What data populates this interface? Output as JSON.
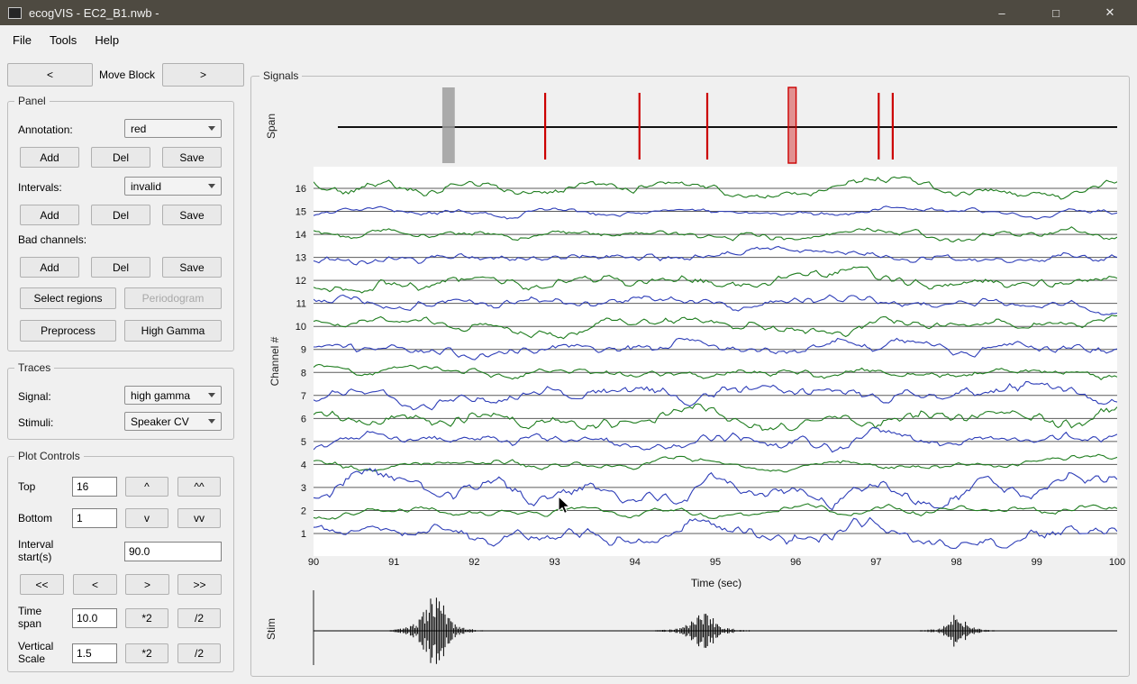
{
  "window": {
    "title": "ecogVIS - EC2_B1.nwb -",
    "minimize": "–",
    "maximize": "□",
    "close": "✕"
  },
  "menu": {
    "file": "File",
    "tools": "Tools",
    "help": "Help"
  },
  "move_block": {
    "prev": "<",
    "label": "Move Block",
    "next": ">"
  },
  "panel": {
    "title": "Panel",
    "annotation": {
      "label": "Annotation:",
      "value": "red",
      "add": "Add",
      "del": "Del",
      "save": "Save"
    },
    "intervals": {
      "label": "Intervals:",
      "value": "invalid",
      "add": "Add",
      "del": "Del",
      "save": "Save"
    },
    "bad_channels": {
      "label": "Bad channels:",
      "add": "Add",
      "del": "Del",
      "save": "Save"
    },
    "select_regions": "Select regions",
    "periodogram": "Periodogram",
    "preprocess": "Preprocess",
    "high_gamma": "High Gamma"
  },
  "traces": {
    "title": "Traces",
    "signal": {
      "label": "Signal:",
      "value": "high gamma"
    },
    "stimuli": {
      "label": "Stimuli:",
      "value": "Speaker CV"
    }
  },
  "plot_controls": {
    "title": "Plot Controls",
    "top": {
      "label": "Top",
      "value": "16",
      "up": "^",
      "up2": "^^"
    },
    "bottom": {
      "label": "Bottom",
      "value": "1",
      "down": "v",
      "down2": "vv"
    },
    "interval_start": {
      "label_line1": "Interval",
      "label_line2": "start(s)",
      "value": "90.0"
    },
    "nav": {
      "first": "<<",
      "prev": "<",
      "next": ">",
      "last": ">>"
    },
    "time_span": {
      "label_line1": "Time",
      "label_line2": "span",
      "value": "10.0",
      "mul": "*2",
      "div": "/2"
    },
    "vertical_scale": {
      "label_line1": "Vertical",
      "label_line2": "Scale",
      "value": "1.5",
      "mul": "*2",
      "div": "/2"
    }
  },
  "signals": {
    "title": "Signals"
  },
  "chart_data": [
    {
      "name": "span-annotations",
      "type": "line",
      "ylabel": "Span",
      "axis_color": "#111111",
      "markers": [
        {
          "kind": "interval",
          "color": "#9e9e9e",
          "pos": 0.142,
          "width": 0.016,
          "opacity": 0.85,
          "border": false
        },
        {
          "kind": "event",
          "color": "#cc0000",
          "pos": 0.266
        },
        {
          "kind": "event",
          "color": "#cc0000",
          "pos": 0.387
        },
        {
          "kind": "event",
          "color": "#cc0000",
          "pos": 0.474
        },
        {
          "kind": "interval",
          "color": "#cc0000",
          "pos": 0.583,
          "width": 0.01,
          "opacity": 0.4,
          "border": true
        },
        {
          "kind": "event",
          "color": "#cc0000",
          "pos": 0.694
        },
        {
          "kind": "event",
          "color": "#cc0000",
          "pos": 0.712
        }
      ]
    },
    {
      "name": "channel-traces",
      "type": "line",
      "xlabel": "Time (sec)",
      "ylabel": "Channel #",
      "x_range": [
        90,
        100
      ],
      "x_ticks": [
        "90",
        "91",
        "92",
        "93",
        "94",
        "95",
        "96",
        "97",
        "98",
        "99",
        "100"
      ],
      "channels": [
        "16",
        "15",
        "14",
        "13",
        "12",
        "11",
        "10",
        "9",
        "8",
        "7",
        "6",
        "5",
        "4",
        "3",
        "2",
        "1"
      ],
      "colors": {
        "even_channel": "#1f7d1f",
        "odd_channel": "#2e3eb8",
        "baseline": "#5b5b5b",
        "background": "#ffffff"
      }
    },
    {
      "name": "stim-waveform",
      "type": "area",
      "ylabel": "Stim",
      "color": "#000000",
      "bursts": [
        {
          "time": 91.5,
          "amplitude": 1.0
        },
        {
          "time": 94.85,
          "amplitude": 0.42
        },
        {
          "time": 98.0,
          "amplitude": 0.36
        }
      ]
    }
  ]
}
